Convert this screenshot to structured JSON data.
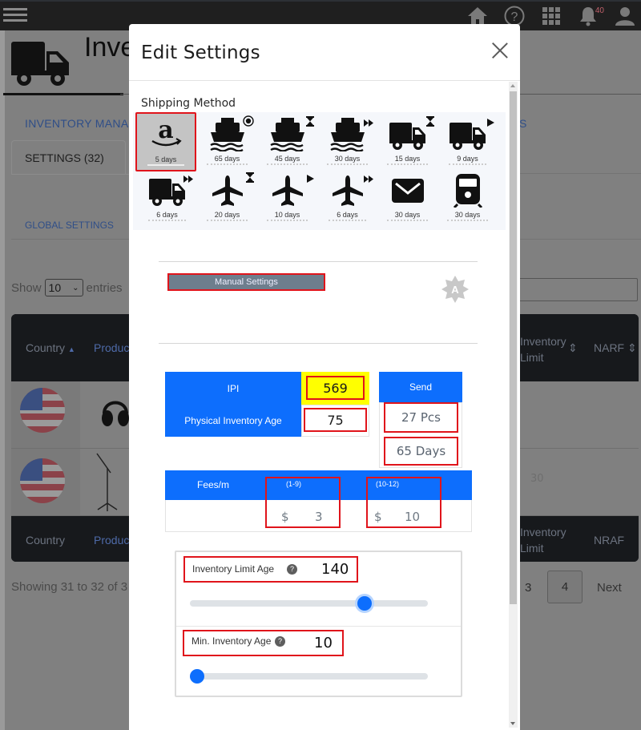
{
  "topbar": {
    "icons": [
      "menu-icon",
      "home-icon",
      "help-icon",
      "apps-grid-icon",
      "bell-icon",
      "user-icon"
    ],
    "notifications_count": "40"
  },
  "page": {
    "title": "Inve",
    "breadcrumb": "INVENTORY MANA",
    "breadcrumb_tail": "S",
    "tab_settings": "SETTINGS (32)",
    "global_settings": "GLOBAL SETTINGS",
    "show_label": "Show",
    "entries_value": "10",
    "entries_label": "entries",
    "table": {
      "headers": {
        "country": "Country",
        "product": "Produc",
        "inventory_limit": "Inventory Limit",
        "narf": "NARF",
        "nraf_footer": "NRAF"
      },
      "rows": [
        {
          "country": "us-flag",
          "product": "headphones",
          "right_value": ""
        },
        {
          "country": "us-flag",
          "product": "mic-stand",
          "right_value": "30"
        }
      ]
    },
    "showing_text": "Showing 31 to 32 of 3",
    "pagination": {
      "page_3": "3",
      "page_4": "4",
      "next": "Next",
      "current": "4"
    }
  },
  "modal": {
    "title": "Edit Settings",
    "close_icon": "close-icon",
    "shipping_label": "Shipping Method",
    "shipping_methods": [
      {
        "icon": "amazon-icon",
        "modifier": "",
        "days": "5 days",
        "selected": true
      },
      {
        "icon": "ship-icon",
        "modifier": "record",
        "days": "65 days",
        "selected": false
      },
      {
        "icon": "ship-icon",
        "modifier": "hourglass",
        "days": "45 days",
        "selected": false
      },
      {
        "icon": "ship-icon",
        "modifier": "fast-forward",
        "days": "30 days",
        "selected": false
      },
      {
        "icon": "truck-icon",
        "modifier": "hourglass",
        "days": "15 days",
        "selected": false
      },
      {
        "icon": "truck-icon",
        "modifier": "play",
        "days": "9 days",
        "selected": false
      },
      {
        "icon": "truck-icon",
        "modifier": "fast-forward",
        "days": "6 days",
        "selected": false
      },
      {
        "icon": "plane-icon",
        "modifier": "hourglass",
        "days": "20 days",
        "selected": false
      },
      {
        "icon": "plane-icon",
        "modifier": "play",
        "days": "10 days",
        "selected": false
      },
      {
        "icon": "plane-icon",
        "modifier": "fast-forward",
        "days": "6 days",
        "selected": false
      },
      {
        "icon": "envelope-icon",
        "modifier": "",
        "days": "30 days",
        "selected": false
      },
      {
        "icon": "train-icon",
        "modifier": "",
        "days": "30 days",
        "selected": false
      }
    ],
    "manual_settings_label": "Manual Settings",
    "auto_badge_letter": "A",
    "ipi_label": "IPI",
    "ipi_value": "569",
    "physical_age_label": "Physical Inventory Age",
    "physical_age_value": "75",
    "send_label": "Send",
    "send_pcs": "27 Pcs",
    "send_days": "65 Days",
    "fees_label": "Fees/m",
    "fee_tiers": [
      {
        "range": "(1-9)",
        "currency": "$",
        "value": "3"
      },
      {
        "range": "(10-12)",
        "currency": "$",
        "value": "10"
      }
    ],
    "inventory_limit_age": {
      "label": "Inventory Limit Age",
      "help": "?",
      "value": "140",
      "slider_fraction": 0.75
    },
    "min_inventory_age": {
      "label": "Min. Inventory Age",
      "help": "?",
      "value": "10",
      "slider_fraction": 0.0
    }
  },
  "colors": {
    "accent_blue": "#0d6efd",
    "highlight_red": "#e0141b",
    "ipi_highlight": "#ffff00",
    "overlay_gray": "#808080"
  }
}
